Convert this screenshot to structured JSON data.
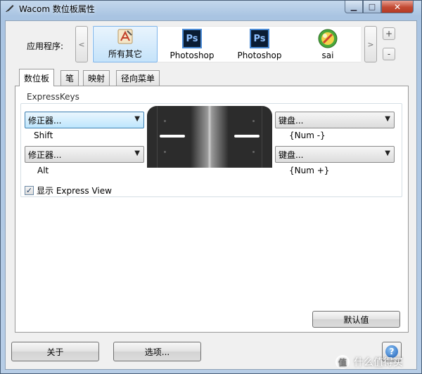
{
  "window": {
    "title": "Wacom 数位板属性",
    "minimize_glyph": "▁",
    "maximize_glyph": "□",
    "close_glyph": "✕"
  },
  "app_bar": {
    "label": "应用程序:",
    "scroll_left": "<",
    "scroll_right": ">",
    "add": "+",
    "remove": "-",
    "apps": [
      {
        "label": "所有其它",
        "icon": "all-apps-icon",
        "selected": true
      },
      {
        "label": "Photoshop",
        "icon": "photoshop-icon",
        "icon_text": "Ps"
      },
      {
        "label": "Photoshop",
        "icon": "photoshop-icon",
        "icon_text": "Ps"
      },
      {
        "label": "sai",
        "icon": "sai-icon"
      }
    ]
  },
  "tabs": [
    {
      "label": "数位板",
      "active": true
    },
    {
      "label": "笔"
    },
    {
      "label": "映射"
    },
    {
      "label": "径向菜单"
    }
  ],
  "expresskeys": {
    "group_label": "ExpressKeys",
    "left_top": {
      "value": "修正器...",
      "key": "Shift"
    },
    "left_bottom": {
      "value": "修正器...",
      "key": "Alt"
    },
    "right_top": {
      "value": "键盘...",
      "key": "{Num -}"
    },
    "right_bottom": {
      "value": "键盘...",
      "key": "{Num +}"
    }
  },
  "show_express_view": {
    "label": "显示 Express View",
    "checked": true,
    "check_glyph": "✓"
  },
  "buttons": {
    "defaults": "默认值",
    "about": "关于",
    "options": "选项...",
    "help_glyph": "?"
  },
  "combo_arrow": "▼",
  "watermark": {
    "text": "什么值得买",
    "glyph": "值"
  },
  "colors": {
    "title_bar": "#a9c4e2",
    "close_button": "#c24a33",
    "selection": "#c5e3fa"
  }
}
